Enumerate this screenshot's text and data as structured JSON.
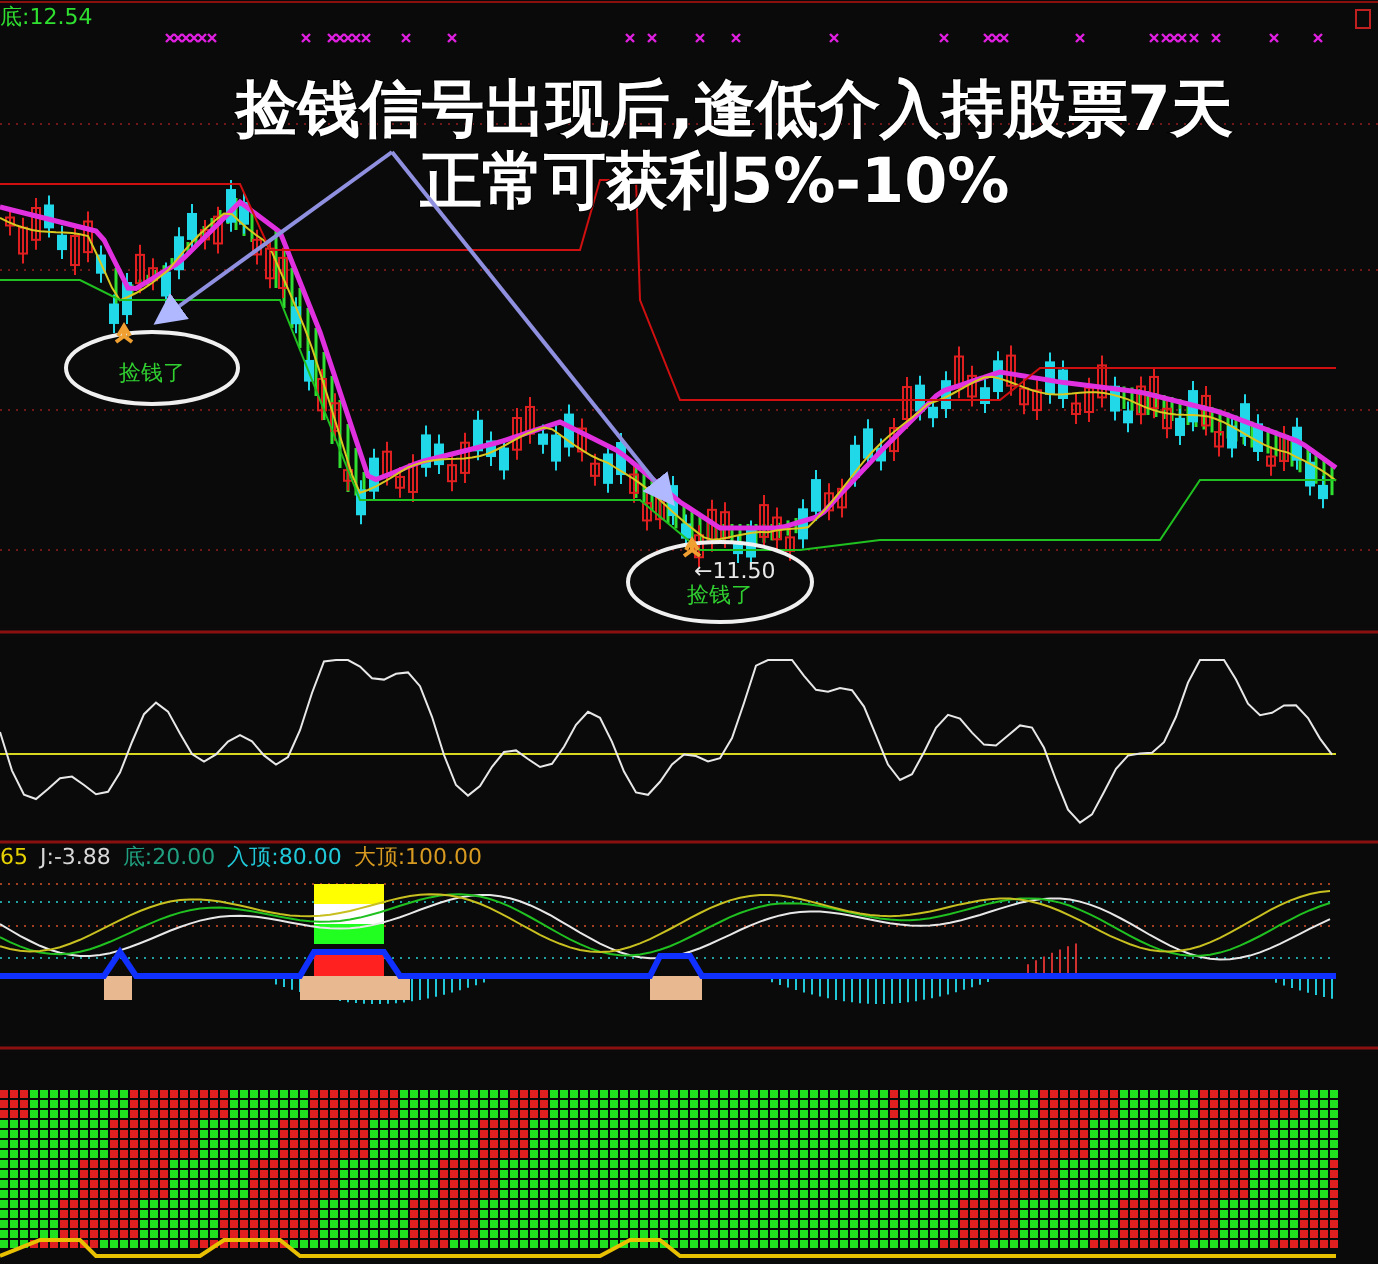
{
  "main_panel": {
    "readout": "底:12.54",
    "headline": [
      "捡钱信号出现后,逢低介入持股票7天",
      "正常可获利5%-10%"
    ],
    "signals": [
      {
        "label": "捡钱了"
      },
      {
        "label": "捡钱了",
        "price": "←11.50"
      }
    ]
  },
  "indicator_panel": {
    "readouts": [
      {
        "text": "65",
        "color": "#e6d200"
      },
      {
        "text": "J:-3.88",
        "color": "#d8d8d8"
      },
      {
        "text": "底:20.00",
        "color": "#20a080"
      },
      {
        "text": "入顶:80.00",
        "color": "#20c8d8"
      },
      {
        "text": "大顶:100.00",
        "color": "#d89a20"
      }
    ]
  }
}
